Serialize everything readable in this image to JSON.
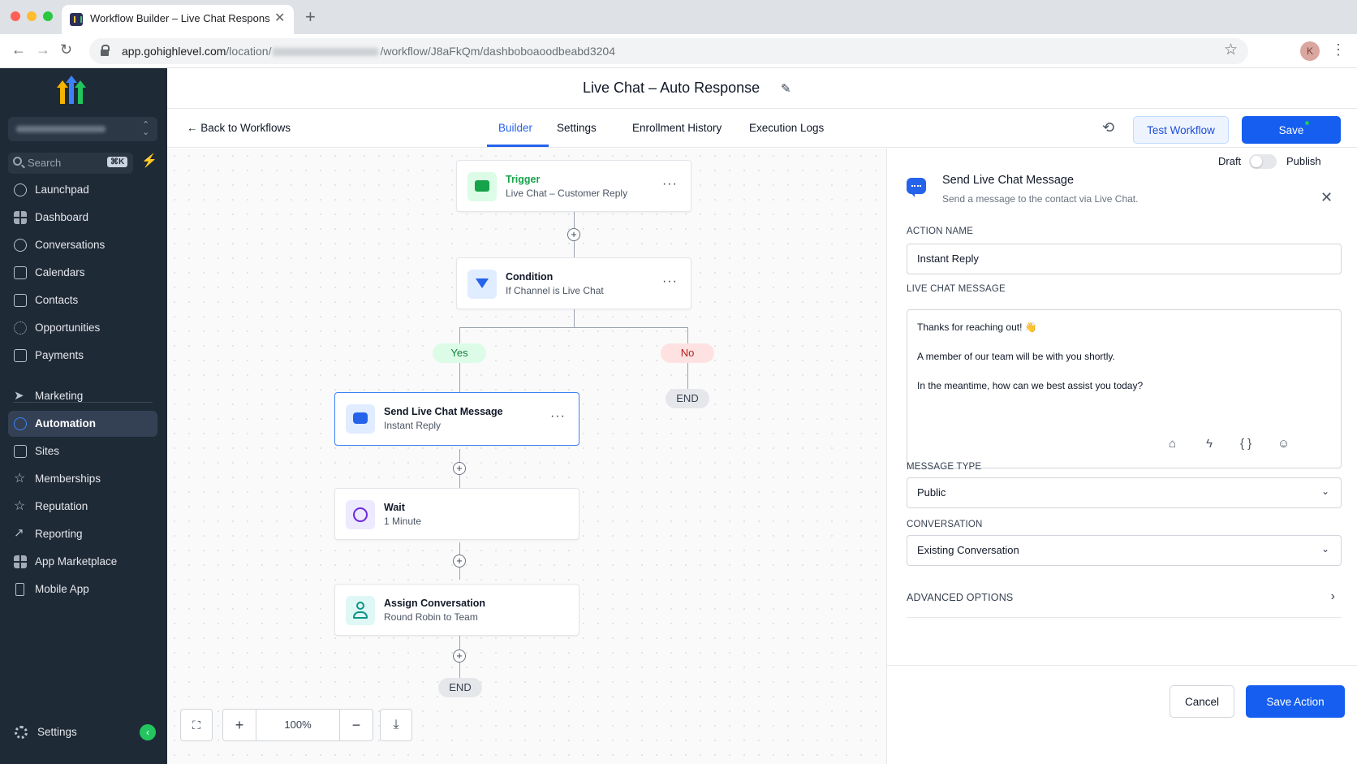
{
  "browser": {
    "tab_title": "Workflow Builder – Live Chat Response",
    "url_host": "app.gohighlevel.com",
    "url_path_start": "/location/",
    "url_path_end": "/workflow/J8aFkQm/dashboboaoodbeabd3204",
    "profile_initial": "K"
  },
  "sidebar": {
    "search_placeholder": "Search",
    "search_shortcut": "⌘K",
    "items_top": [
      {
        "label": "Launchpad",
        "icon": "rocket-icon"
      },
      {
        "label": "Dashboard",
        "icon": "grid-icon"
      },
      {
        "label": "Conversations",
        "icon": "chat-bubble-icon"
      },
      {
        "label": "Calendars",
        "icon": "calendar-icon"
      },
      {
        "label": "Contacts",
        "icon": "contacts-icon"
      },
      {
        "label": "Opportunities",
        "icon": "opportunities-icon"
      },
      {
        "label": "Payments",
        "icon": "receipt-icon"
      }
    ],
    "items_bottom": [
      {
        "label": "Marketing",
        "icon": "send-icon"
      },
      {
        "label": "Automation",
        "icon": "automation-icon",
        "active": true
      },
      {
        "label": "Sites",
        "icon": "sites-icon"
      },
      {
        "label": "Memberships",
        "icon": "star-icon"
      },
      {
        "label": "Reputation",
        "icon": "star-icon"
      },
      {
        "label": "Reporting",
        "icon": "trend-icon"
      },
      {
        "label": "App Marketplace",
        "icon": "grid-icon"
      },
      {
        "label": "Mobile App",
        "icon": "phone-icon"
      }
    ],
    "settings_label": "Settings"
  },
  "header": {
    "workflow_title": "Live Chat – Auto Response",
    "back_label": "Back to Workflows",
    "tabs": [
      {
        "label": "Builder",
        "active": true
      },
      {
        "label": "Settings"
      },
      {
        "label": "Enrollment History"
      },
      {
        "label": "Execution Logs"
      }
    ],
    "test_button": "Test Workflow",
    "save_button": "Save"
  },
  "canvas": {
    "trigger": {
      "title": "Trigger",
      "subtitle": "Live Chat – Customer Reply"
    },
    "condition": {
      "title": "Condition",
      "subtitle": "If Channel is Live Chat"
    },
    "yes_label": "Yes",
    "no_label": "No",
    "end_label": "END",
    "send_message": {
      "title": "Send Live Chat Message",
      "subtitle": "Instant Reply"
    },
    "wait": {
      "title": "Wait",
      "subtitle": "1 Minute"
    },
    "assign": {
      "title": "Assign Conversation",
      "subtitle": "Round Robin to Team"
    },
    "zoom_level": "100%"
  },
  "panel": {
    "draft_label": "Draft",
    "publish_label": "Publish",
    "title": "Send Live Chat Message",
    "subtitle": "Send a message to the contact via Live Chat.",
    "action_name_label": "ACTION NAME",
    "action_name_value": "Instant Reply",
    "message_label": "LIVE CHAT MESSAGE",
    "message_lines": [
      "Thanks for reaching out! 👋",
      "A member of our team will be with you shortly.",
      "In the meantime, how can we best assist you today?"
    ],
    "message_type_label": "MESSAGE TYPE",
    "message_type_value": "Public",
    "conversation_label": "CONVERSATION",
    "conversation_value": "Existing Conversation",
    "advanced_label": "ADVANCED OPTIONS",
    "cancel_button": "Cancel",
    "save_action_button": "Save Action"
  },
  "colors": {
    "primary": "#155eef",
    "sidebar_bg": "#1f2a37",
    "yes_bg": "#dcfce7",
    "no_bg": "#fee2e2"
  }
}
